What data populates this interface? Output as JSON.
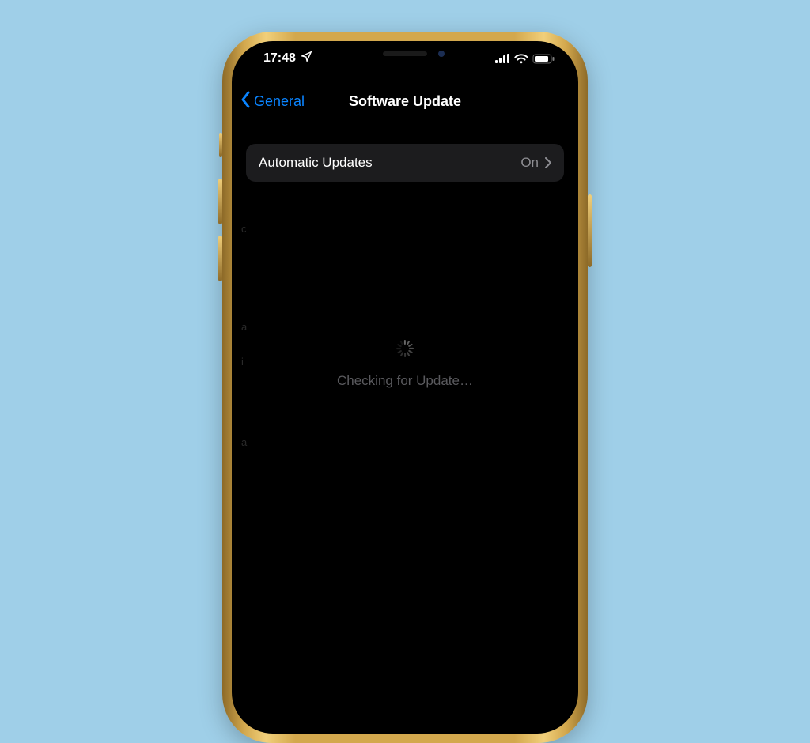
{
  "status": {
    "time": "17:48",
    "location_icon": "location-arrow",
    "cellular_bars": 4,
    "wifi": true,
    "battery_pct": 85
  },
  "nav": {
    "back_label": "General",
    "title": "Software Update"
  },
  "settings": {
    "automatic_updates": {
      "label": "Automatic Updates",
      "value": "On"
    }
  },
  "loading": {
    "text": "Checking for Update…"
  },
  "colors": {
    "accent": "#0a84ff"
  }
}
